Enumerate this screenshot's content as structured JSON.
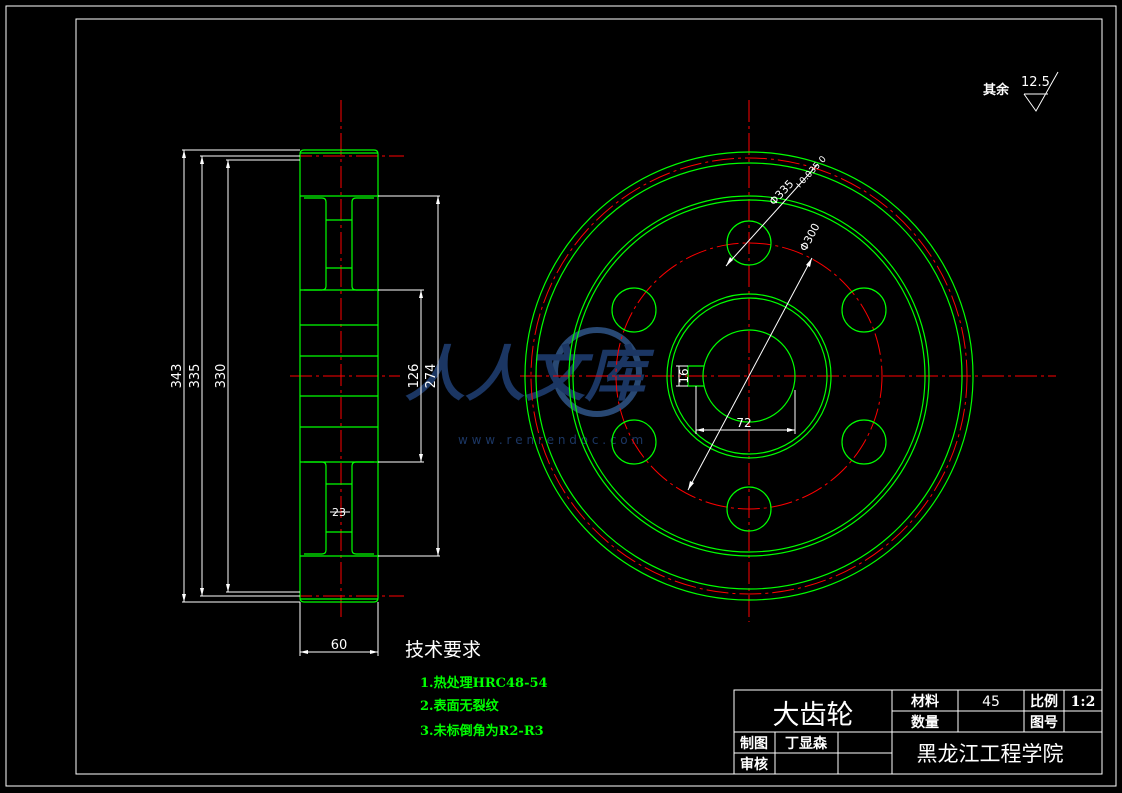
{
  "drawing": {
    "part_name": "大齿轮",
    "school": "黑龙江工程学院",
    "labels": {
      "material": "材料",
      "quantity": "数量",
      "scale": "比例",
      "drawing_no": "图号",
      "drawn_by": "制图",
      "reviewed_by": "审核"
    },
    "values": {
      "material": "45",
      "scale": "1:2",
      "drawn_by": "丁显森"
    }
  },
  "roughness": {
    "label": "其余",
    "value": "12.5"
  },
  "technical_requirements": {
    "title": "技术要求",
    "items": [
      "1.热处理HRC48-54",
      "2.表面无裂纹",
      "3.未标倒角为R2-R3"
    ]
  },
  "side_view": {
    "dims": {
      "d343": "343",
      "d335": "335",
      "d330": "330",
      "d126": "126",
      "d274": "274",
      "d60": "60",
      "d23": "23"
    }
  },
  "front_view": {
    "dims": {
      "outer": "Φ335",
      "tolerance": "+0.035 0",
      "pitch": "Φ300",
      "bore": "16",
      "keyway": "72"
    }
  },
  "watermark": {
    "text": "人人文库",
    "url": "w w w . r e n r e n d o c . c o m"
  },
  "colors": {
    "background": "#000000",
    "frame": "#ffffff",
    "outline": "#00ff00",
    "centerline": "#ff0000",
    "text": "#ffffff",
    "tech_text": "#00ff00"
  }
}
